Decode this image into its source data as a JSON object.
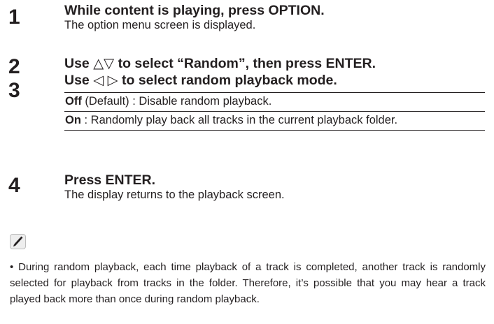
{
  "steps": [
    {
      "number": "1",
      "title": "While content is playing, press OPTION.",
      "body": "The option menu screen is displayed."
    },
    {
      "number": "2",
      "title": "Use △▽ to select “Random”, then press ENTER."
    },
    {
      "number": "3",
      "title": "Use ◁ ▷ to select random playback mode."
    },
    {
      "number": "4",
      "title": "Press ENTER.",
      "body": "The display returns to the playback screen."
    }
  ],
  "options": [
    {
      "name": "Off",
      "desc": " (Default) : Disable random playback."
    },
    {
      "name": "On",
      "desc": " : Randomly play back all tracks in the current playback folder."
    }
  ],
  "note": {
    "icon": "pencil-icon",
    "bullet": "•",
    "text": "During random playback, each time playback of a track is completed, another track is randomly selected for playback from tracks in the folder. Therefore, it’s possible that you may hear a track played back more than once during random playback."
  }
}
